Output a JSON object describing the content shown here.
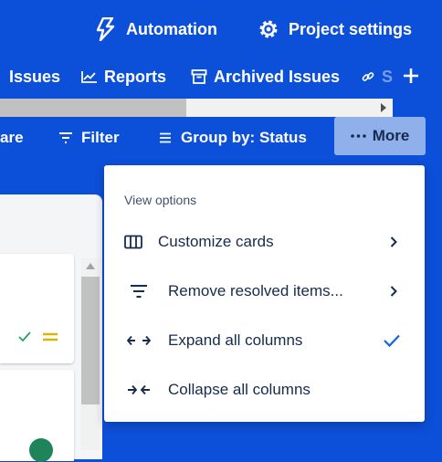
{
  "header": {
    "automation_label": "Automation",
    "settings_label": "Project settings"
  },
  "tabs": [
    {
      "label": "Issues",
      "icon": "issues-icon"
    },
    {
      "label": "Reports",
      "icon": "chart-icon"
    },
    {
      "label": "Archived Issues",
      "icon": "archive-icon"
    },
    {
      "label": "S",
      "icon": "link-icon"
    }
  ],
  "toolbar": {
    "share_partial": "are",
    "filter_label": "Filter",
    "group_by_label": "Group by: Status",
    "more_label": "More"
  },
  "menu": {
    "heading": "View options",
    "items": [
      {
        "label": "Customize cards",
        "icon": "columns-icon",
        "has_submenu": true
      },
      {
        "label": "Remove resolved items...",
        "icon": "filter-lines-icon",
        "has_submenu": true
      },
      {
        "label": "Expand all columns",
        "icon": "expand-arrows-icon",
        "checked": true
      },
      {
        "label": "Collapse all columns",
        "icon": "collapse-arrows-icon",
        "checked": false
      }
    ]
  },
  "colors": {
    "background": "#0c4fd8",
    "more_button_bg": "#8fb0eb",
    "check_color": "#0c66e4",
    "done_check": "#22a06b",
    "priority_medium": "#e2b203",
    "avatar_green": "#1f845a"
  }
}
